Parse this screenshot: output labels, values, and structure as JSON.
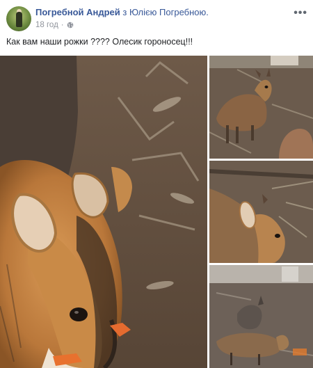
{
  "post": {
    "author": "Погребной Андрей",
    "with_word": "з",
    "tagged": "Юлією Погребною.",
    "time": "18 год",
    "dot": "·",
    "privacy_icon": "globe-icon",
    "more_icon": "more-dots-icon",
    "text": "Как вам наши рожки ???? Олесик гороносец!!!"
  },
  "photos": {
    "main": {
      "subject": "photo-deer-closeup"
    },
    "thumb1": {
      "subject": "photo-deer-standing"
    },
    "thumb2": {
      "subject": "photo-deer-side"
    },
    "thumb3": {
      "subject": "photo-deer-group"
    }
  },
  "colors": {
    "link": "#385898",
    "meta": "#90949c",
    "text": "#1c1e21"
  }
}
